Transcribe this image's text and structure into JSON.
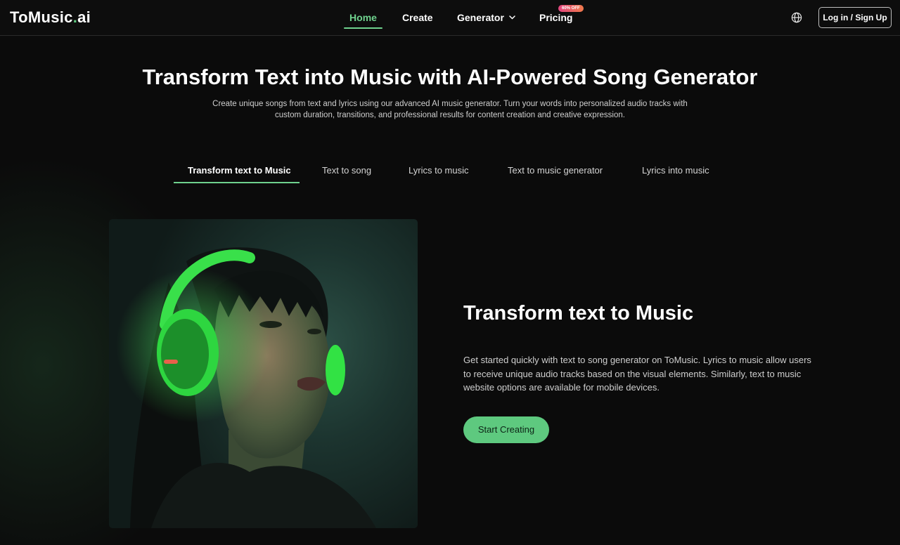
{
  "header": {
    "logo_main": "ToMusic",
    "logo_dot": ".",
    "logo_tld": "ai",
    "nav": {
      "home": "Home",
      "create": "Create",
      "generator": "Generator",
      "pricing": "Pricing",
      "pricing_badge": "60% OFF"
    },
    "login_label": "Log in / Sign Up",
    "globe_icon": "globe-icon",
    "active_color": "#6fd28e"
  },
  "hero": {
    "title": "Transform Text into Music with AI-Powered Song Generator",
    "subtitle": "Create unique songs from text and lyrics using our advanced AI music generator. Turn your words into personalized audio tracks with custom duration, transitions, and professional results for content creation and creative expression."
  },
  "tabs": [
    {
      "label": "Transform text to Music",
      "active": true
    },
    {
      "label": "Text to song",
      "active": false
    },
    {
      "label": "Lyrics to music",
      "active": false
    },
    {
      "label": "Text to music generator",
      "active": false
    },
    {
      "label": "Lyrics into music",
      "active": false
    }
  ],
  "feature": {
    "title": "Transform text to Music",
    "description": "Get started quickly with text to song generator on ToMusic. Lyrics to music allow users to receive unique audio tracks based on the visual elements. Similarly, text to music website options are available for mobile devices.",
    "cta": "Start Creating",
    "cta_color": "#5ec97f",
    "image_subject": "woman-with-green-headphones"
  }
}
